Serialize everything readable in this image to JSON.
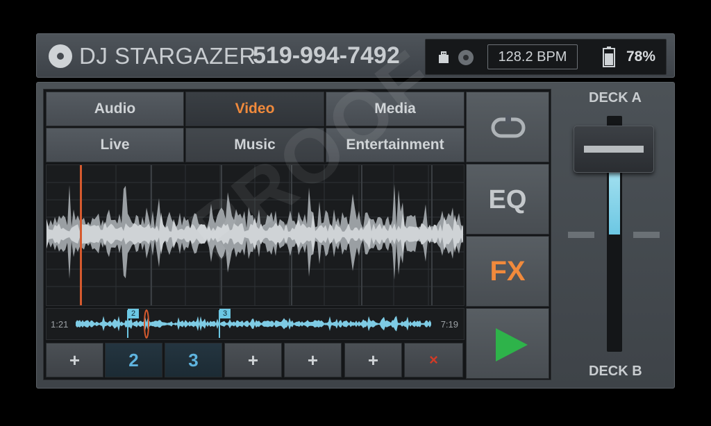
{
  "header": {
    "title": "DJ STARGAZER",
    "phone": "519-994-7492",
    "bpm": "128.2 BPM",
    "battery": "78%"
  },
  "tabs": [
    "Audio",
    "Video",
    "Media",
    "Live",
    "Music",
    "Entertainment"
  ],
  "active_tab": "Video",
  "waveform": {
    "time_start": "1:21",
    "time_end": "7:19",
    "markers": [
      "2",
      "3"
    ]
  },
  "cue_buttons": [
    "+",
    "2",
    "3",
    "+",
    "+",
    "+",
    "×"
  ],
  "side_buttons": {
    "loop": "loop-icon",
    "eq": "EQ",
    "fx": "FX",
    "play": "play-icon"
  },
  "deck": {
    "top_label": "DECK A",
    "bottom_label": "DECK B"
  },
  "watermark": "PROOF",
  "colors": {
    "accent": "#f08a3c",
    "cue_blue": "#5fb4df",
    "play_green": "#2eb34a",
    "delete_red": "#d23a26"
  }
}
